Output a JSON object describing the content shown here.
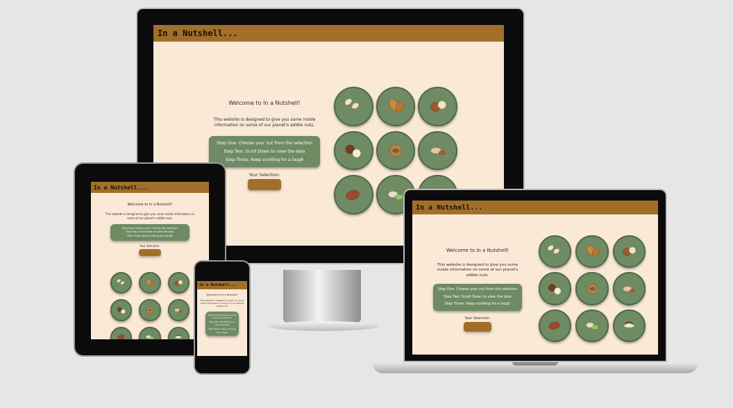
{
  "site": {
    "title": "In a Nutshell...",
    "welcome": "Welcome to In a Nutshell!",
    "description": "This website is designed to give you some inside information on some of our planet's edible nuts.",
    "steps": [
      "Step One: Choose your nut from the selection",
      "Step Two: Scroll Down to view the data",
      "Step Three: Keep scrolling for a laugh"
    ],
    "selection_label": "Your Selection:"
  },
  "nuts": [
    {
      "name": "cashew-icon"
    },
    {
      "name": "almond-icon"
    },
    {
      "name": "hazelnut-icon"
    },
    {
      "name": "macadamia-icon"
    },
    {
      "name": "walnut-icon"
    },
    {
      "name": "peanut-icon"
    },
    {
      "name": "pecan-icon"
    },
    {
      "name": "pistachio-icon"
    },
    {
      "name": "brazil-nut-icon"
    }
  ],
  "colors": {
    "header": "#a16f2a",
    "page_bg": "#fbe9d7",
    "steps_box": "#6e8b64",
    "nut_circle": "#6e8b64",
    "background": "#e6e6e6"
  }
}
